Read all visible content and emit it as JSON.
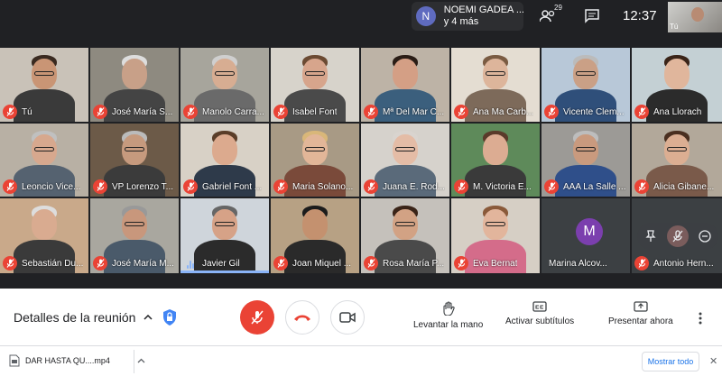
{
  "topbar": {
    "presenter_initial": "N",
    "presenter_line1": "NOEMI GADEA ...",
    "presenter_line2": "y 4 más",
    "people_count": "29",
    "time": "12:37",
    "self_label": "Tú"
  },
  "participants": [
    {
      "name": "Tú",
      "muted": true,
      "bg": "#c9c2b8",
      "skin": "#c99575",
      "shirt": "#3a3a3a",
      "hair": "#3a2a20"
    },
    {
      "name": "José María S...",
      "muted": true,
      "bg": "#8e8a80",
      "skin": "#c8a088",
      "shirt": "#444",
      "hair": "#ddd"
    },
    {
      "name": "Manolo Carra...",
      "muted": true,
      "bg": "#a7a59c",
      "skin": "#d7ad92",
      "shirt": "#6a6a6a",
      "hair": "#cfcfcf"
    },
    {
      "name": "Isabel Font",
      "muted": true,
      "bg": "#d7d3cb",
      "skin": "#d7a58c",
      "shirt": "#4a4a4a",
      "hair": "#6b4a32"
    },
    {
      "name": "Mª Del Mar C...",
      "muted": true,
      "bg": "#bdb3a6",
      "skin": "#d49f85",
      "shirt": "#3b5f7d",
      "hair": "#2a1d16"
    },
    {
      "name": "Ana Ma Carb...",
      "muted": true,
      "bg": "#e4ddd2",
      "skin": "#ddb59b",
      "shirt": "#7d6a5a",
      "hair": "#7a5b42"
    },
    {
      "name": "Vicente Clem...",
      "muted": true,
      "bg": "#b8c8d8",
      "skin": "#caa086",
      "shirt": "#2f4f7a",
      "hair": "#bbb"
    },
    {
      "name": "Ana Llorach",
      "muted": true,
      "bg": "#c4d0d4",
      "skin": "#e0b69c",
      "shirt": "#2b2b2b",
      "hair": "#3a2418"
    },
    {
      "name": "Leoncio Vice...",
      "muted": true,
      "bg": "#b8b0a4",
      "skin": "#d7a88e",
      "shirt": "#556270",
      "hair": "#c0c0c0"
    },
    {
      "name": "VP Lorenzo T...",
      "muted": true,
      "bg": "#6c5a48",
      "skin": "#c69a7e",
      "shirt": "#3b3b3b",
      "hair": "#bbb"
    },
    {
      "name": "Gabriel Font ...",
      "muted": true,
      "bg": "#d8d1c6",
      "skin": "#dcaa8e",
      "shirt": "#2e3a4a",
      "hair": "#5a3d28"
    },
    {
      "name": "Maria Solano...",
      "muted": true,
      "bg": "#a89a85",
      "skin": "#e2b698",
      "shirt": "#7a4a3a",
      "hair": "#d9b779"
    },
    {
      "name": "Juana E. Rod...",
      "muted": true,
      "bg": "#d6d2cc",
      "skin": "#e4bca6",
      "shirt": "#5a6a7a",
      "hair": "#d9d4cf"
    },
    {
      "name": "M. Victoria E...",
      "muted": true,
      "bg": "#5e8a5a",
      "skin": "#dcac92",
      "shirt": "#3a3a3a",
      "hair": "#5a3a2a"
    },
    {
      "name": "AAA La Salle ...",
      "muted": true,
      "bg": "#9c9a96",
      "skin": "#c99a7e",
      "shirt": "#2f4f8a",
      "hair": "#bdbdbd"
    },
    {
      "name": "Alicia Gibane...",
      "muted": true,
      "bg": "#b2a89a",
      "skin": "#dcae92",
      "shirt": "#7a5a4a",
      "hair": "#4a2f20"
    },
    {
      "name": "Sebastián Du...",
      "muted": true,
      "bg": "#c9a98a",
      "skin": "#d9ab90",
      "shirt": "#3a3a3a",
      "hair": "#ddd"
    },
    {
      "name": "José María M...",
      "muted": true,
      "bg": "#a9a79f",
      "skin": "#c8977c",
      "shirt": "#4a5a6a",
      "hair": "#999"
    },
    {
      "name": "Javier Gil",
      "muted": false,
      "speaking": true,
      "bg": "#cfd5db",
      "skin": "#d6a287",
      "shirt": "#2b2b2b",
      "hair": "#666"
    },
    {
      "name": "Joan Miquel ...",
      "muted": true,
      "bg": "#b7a184",
      "skin": "#c4916f",
      "shirt": "#2a2a2a",
      "hair": "#1c1c1c"
    },
    {
      "name": "Rosa María P...",
      "muted": true,
      "bg": "#c5c1bb",
      "skin": "#d2a284",
      "shirt": "#4a4a4a",
      "hair": "#3a2418"
    },
    {
      "name": "Eva Bernat",
      "muted": true,
      "bg": "#d6cfc5",
      "skin": "#e2b59c",
      "shirt": "#d46c8a",
      "hair": "#8a5a3a"
    },
    {
      "name": "Marina Alcov...",
      "muted": false,
      "avatar": "M",
      "bg": "#3c4043"
    },
    {
      "name": "Antonio Hern...",
      "muted": true,
      "avatar_tile": true,
      "bg": "#3c4043"
    }
  ],
  "controls": {
    "details": "Detalles de la reunión",
    "raise_hand": "Levantar la mano",
    "captions": "Activar subtítulos",
    "present": "Presentar ahora"
  },
  "download": {
    "file": "DAR HASTA QU....mp4",
    "show_all": "Mostrar todo"
  },
  "colors": {
    "meet_bg": "#202124",
    "mic_off": "#ea4335",
    "accent": "#1a73e8"
  }
}
